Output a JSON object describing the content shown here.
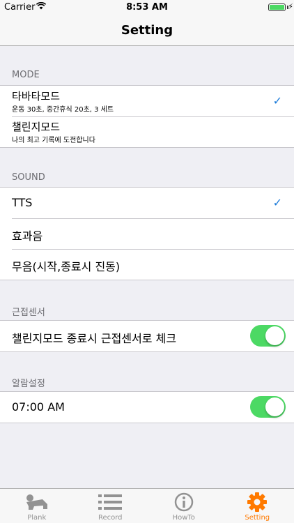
{
  "status_bar": {
    "carrier": "Carrier",
    "time": "8:53 AM"
  },
  "nav": {
    "title": "Setting"
  },
  "mode": {
    "header": "MODE",
    "items": [
      {
        "title": "타바타모드",
        "subtitle": "운동 30초, 중간휴식 20초, 3 세트",
        "checked": true
      },
      {
        "title": "챌린지모드",
        "subtitle": "나의 최고 기록에 도전합니다",
        "checked": false
      }
    ]
  },
  "sound": {
    "header": "SOUND",
    "items": [
      {
        "title": "TTS",
        "checked": true
      },
      {
        "title": "효과음",
        "checked": false
      },
      {
        "title": "무음(시작,종료시 진동)",
        "checked": false
      }
    ]
  },
  "proximity": {
    "header": "근접센서",
    "label": "챌린지모드 종료시 근접센서로 체크",
    "toggle_on": true
  },
  "alarm": {
    "header": "알람설정",
    "label": "07:00 AM",
    "toggle_on": true
  },
  "tabs": [
    {
      "label": "Plank",
      "icon": "plank-icon",
      "active": false
    },
    {
      "label": "Record",
      "icon": "list-icon",
      "active": false
    },
    {
      "label": "HowTo",
      "icon": "info-icon",
      "active": false
    },
    {
      "label": "Setting",
      "icon": "gear-icon",
      "active": true
    }
  ],
  "colors": {
    "accent": "#ff7a00",
    "check": "#1a7ad9",
    "toggle_on": "#4cd964",
    "background": "#efeff4"
  }
}
